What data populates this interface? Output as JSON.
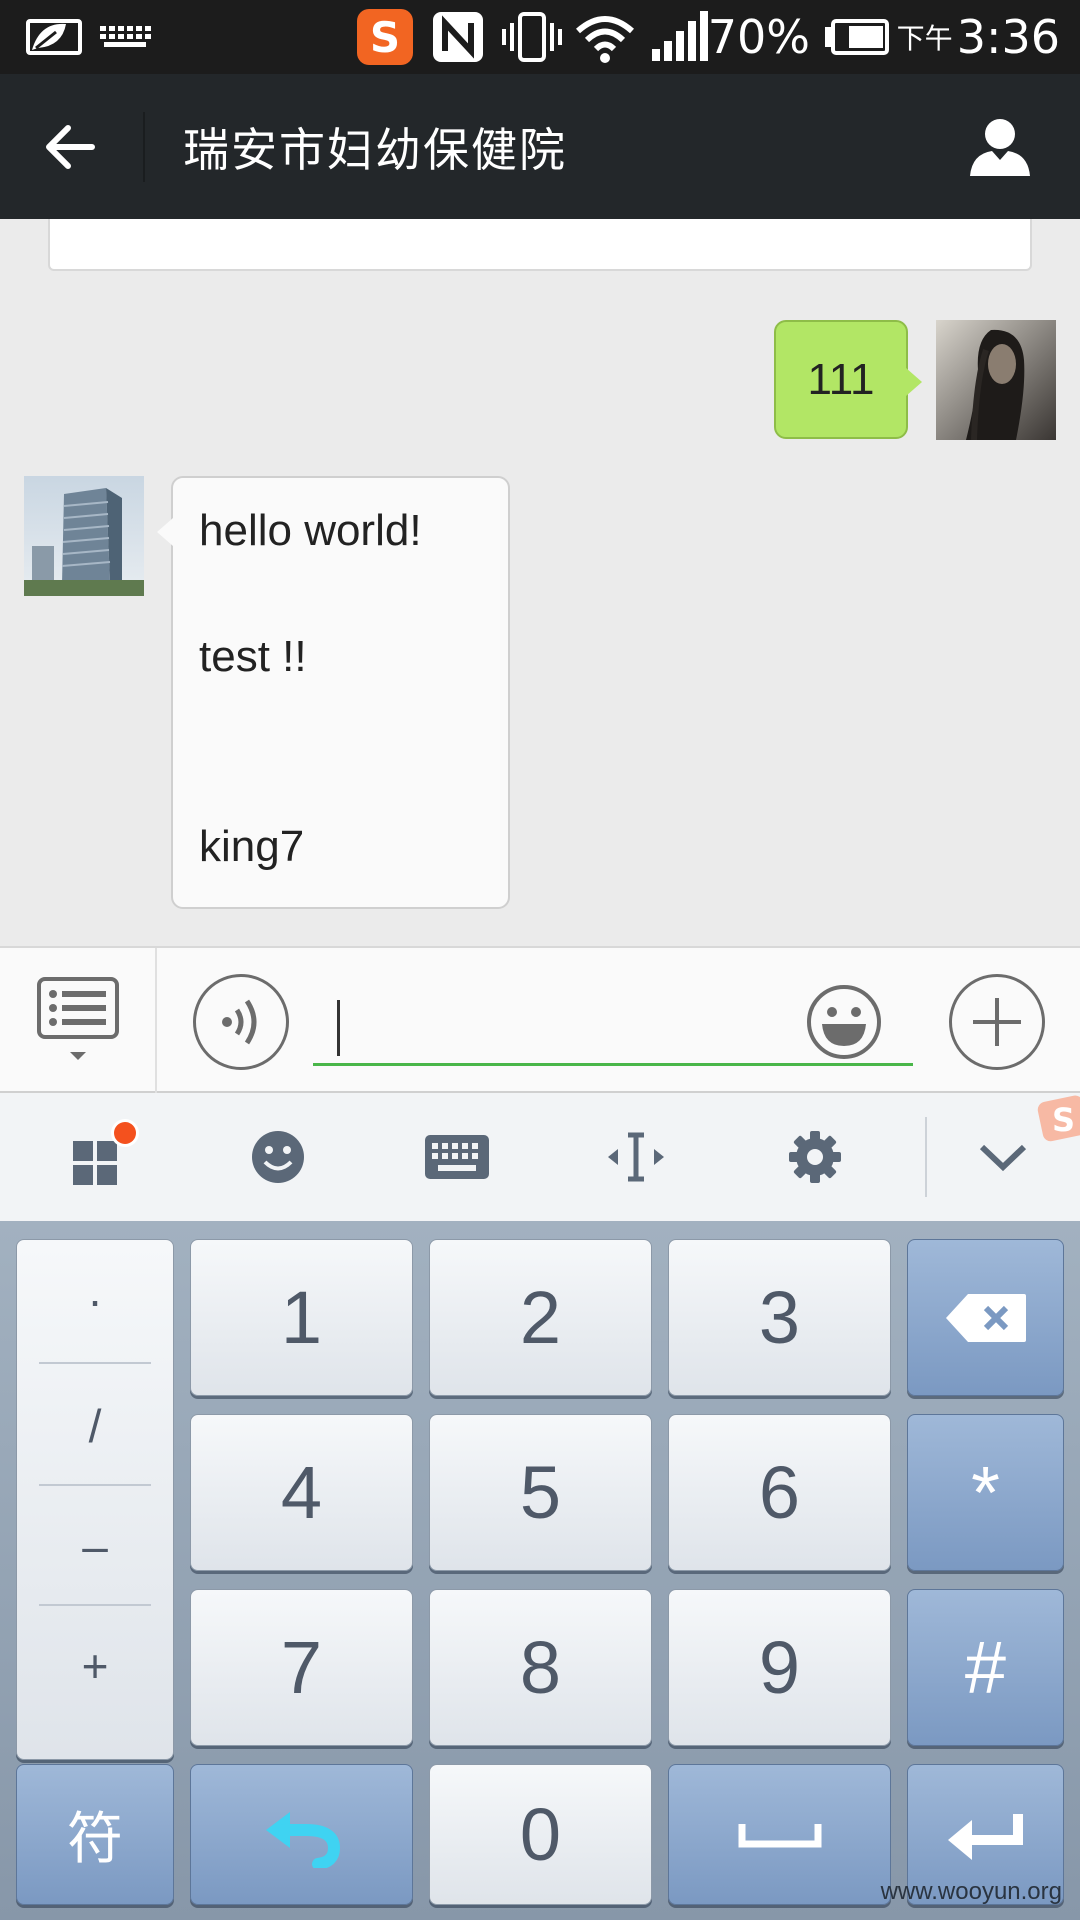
{
  "status_bar": {
    "battery_percent": "70%",
    "time_period": "下午",
    "time": "3:36",
    "icons": [
      "leaf-icon",
      "keyboard-icon",
      "sogou-icon",
      "nfc-icon",
      "vibrate-icon",
      "wifi-icon",
      "signal-icon",
      "battery-icon"
    ],
    "sogou_letter": "S"
  },
  "header": {
    "title": "瑞安市妇幼保健院",
    "back_icon": "arrow-left-icon",
    "profile_icon": "person-icon"
  },
  "chat": {
    "messages": [
      {
        "sender": "me",
        "text": "111"
      },
      {
        "sender": "other",
        "lines": [
          "hello world!",
          "test !!",
          "king7"
        ]
      }
    ]
  },
  "input_bar": {
    "value": "",
    "menu_icon": "list-menu-icon",
    "voice_icon": "voice-icon",
    "emoji_icon": "smiley-icon",
    "plus_icon": "plus-icon"
  },
  "keyboard_toolbar": {
    "items": [
      "apps-icon",
      "emoji-icon",
      "keyboard-icon",
      "cursor-icon",
      "settings-icon",
      "collapse-icon"
    ]
  },
  "keyboard": {
    "symbols": [
      "·",
      "/",
      "–",
      "+"
    ],
    "digits": [
      "1",
      "2",
      "3",
      "4",
      "5",
      "6",
      "7",
      "8",
      "9",
      "0"
    ],
    "right_keys": [
      "*",
      "#"
    ],
    "symbol_key": "符",
    "watermark": "www.wooyun.org"
  },
  "colors": {
    "header_bg": "#23272a",
    "chat_bg": "#ebebeb",
    "my_bubble": "#b2e665",
    "input_underline": "#49b649",
    "key_blue": "#7b99c2"
  }
}
